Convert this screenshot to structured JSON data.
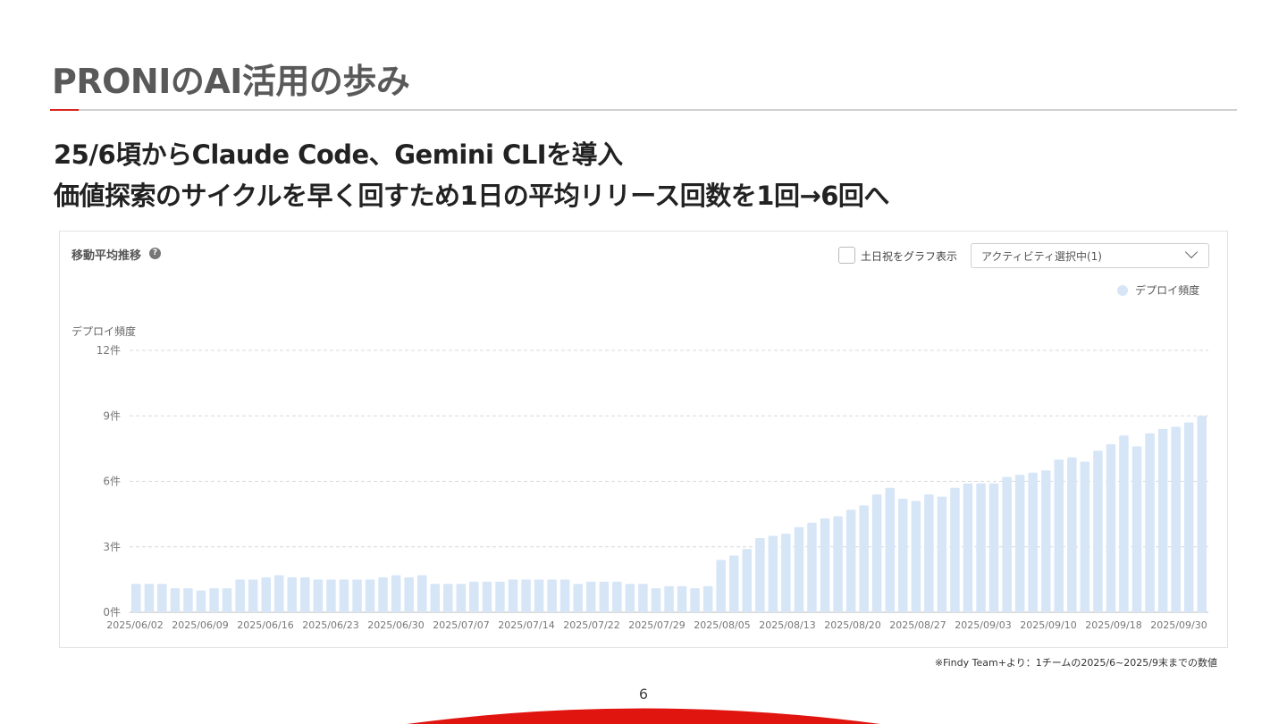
{
  "slide": {
    "title": "PRONIのAI活用の歩み",
    "subtitle_line1": "25/6頃からClaude Code、Gemini CLIを導入",
    "subtitle_line2": "価値探索のサイクルを早く回すため1日の平均リリース回数を1回→6回へ",
    "footnote": "※Findy Team+より：1チームの2025/6~2025/9末までの数値",
    "page_number": "6",
    "accent_color": "#d8241f"
  },
  "panel": {
    "title": "移動平均推移",
    "help_icon": "question-circle-icon",
    "help_glyph": "?",
    "checkbox_label": "土日祝をグラフ表示",
    "checkbox_checked": false,
    "dropdown_value": "アクティビティ選択中(1)",
    "dropdown_icon": "chevron-down-icon"
  },
  "chart_data": {
    "type": "bar",
    "series": [
      {
        "name": "デプロイ頻度",
        "color": "#d6e6f7",
        "values": [
          1.3,
          1.3,
          1.3,
          1.1,
          1.1,
          1.0,
          1.1,
          1.1,
          1.5,
          1.5,
          1.6,
          1.7,
          1.6,
          1.6,
          1.5,
          1.5,
          1.5,
          1.5,
          1.5,
          1.6,
          1.7,
          1.6,
          1.7,
          1.3,
          1.3,
          1.3,
          1.4,
          1.4,
          1.4,
          1.5,
          1.5,
          1.5,
          1.5,
          1.5,
          1.3,
          1.4,
          1.4,
          1.4,
          1.3,
          1.3,
          1.1,
          1.2,
          1.2,
          1.1,
          1.2,
          2.4,
          2.6,
          2.9,
          3.4,
          3.5,
          3.6,
          3.9,
          4.1,
          4.3,
          4.4,
          4.7,
          4.9,
          5.4,
          5.7,
          5.2,
          5.1,
          5.4,
          5.3,
          5.7,
          5.9,
          5.9,
          5.9,
          6.2,
          6.3,
          6.4,
          6.5,
          7.0,
          7.1,
          6.9,
          7.4,
          7.7,
          8.1,
          7.6,
          8.2,
          8.4,
          8.5,
          8.7,
          9.0
        ]
      }
    ],
    "x_tick_labels": [
      "2025/06/02",
      "2025/06/09",
      "2025/06/16",
      "2025/06/23",
      "2025/06/30",
      "2025/07/07",
      "2025/07/14",
      "2025/07/22",
      "2025/07/29",
      "2025/08/05",
      "2025/08/13",
      "2025/08/20",
      "2025/08/27",
      "2025/09/03",
      "2025/09/10",
      "2025/09/18",
      "2025/09/30"
    ],
    "y_ticks": [
      0,
      3,
      6,
      9,
      12
    ],
    "y_tick_labels": [
      "0件",
      "3件",
      "6件",
      "9件",
      "12件"
    ],
    "ylabel": "デプロイ頻度",
    "ylim": [
      0,
      12
    ],
    "grid": true,
    "legend_position": "top-right"
  }
}
